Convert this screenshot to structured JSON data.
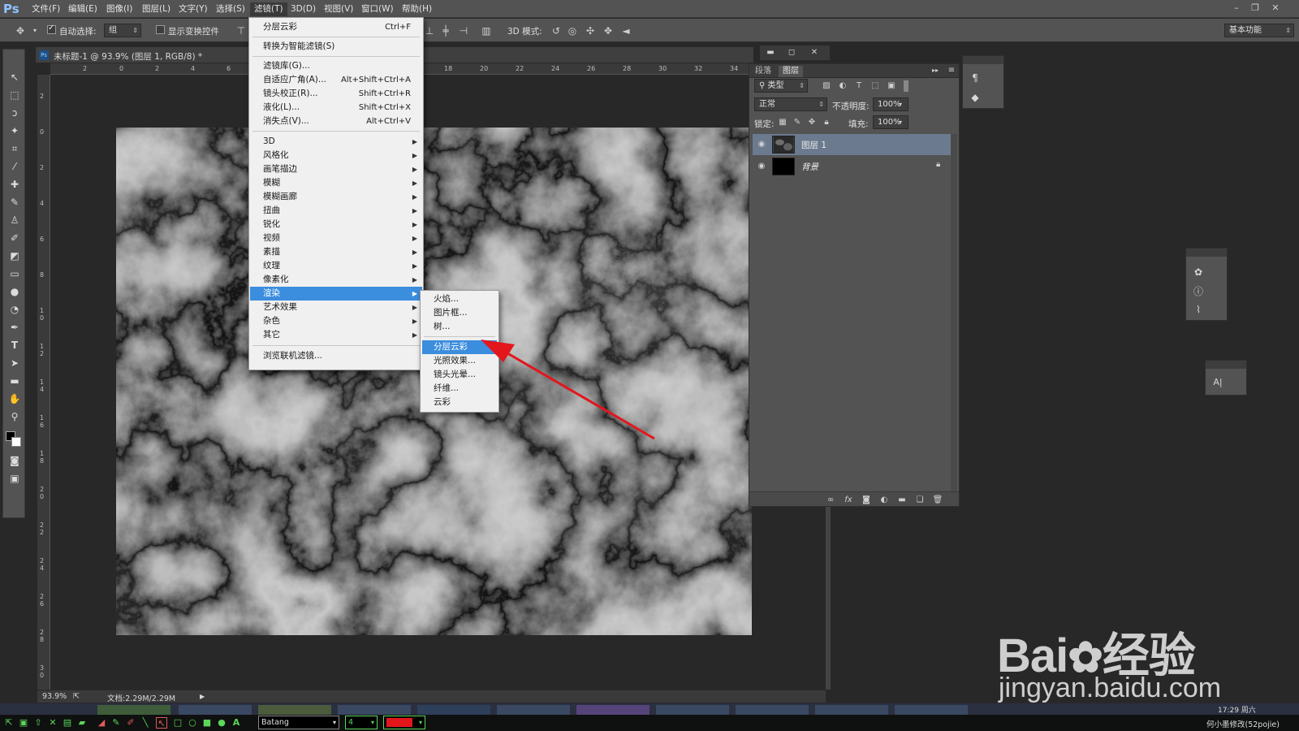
{
  "app": {
    "logo": "Ps"
  },
  "menubar": {
    "items": [
      "文件(F)",
      "编辑(E)",
      "图像(I)",
      "图层(L)",
      "文字(Y)",
      "选择(S)",
      "滤镜(T)",
      "3D(D)",
      "视图(V)",
      "窗口(W)",
      "帮助(H)"
    ],
    "active_index": 6
  },
  "options": {
    "auto_select_label": "自动选择:",
    "auto_select_value": "组",
    "show_transform_label": "显示变换控件",
    "mode3d_label": "3D 模式:",
    "workspace": "基本功能"
  },
  "document": {
    "title": "未标题-1 @ 93.9% (图层 1, RGB/8) *",
    "zoom": "93.9%",
    "doc_size": "文档:2.29M/2.29M",
    "ruler_h": [
      "2",
      "0",
      "2",
      "4",
      "6",
      "18",
      "20",
      "22",
      "24",
      "26",
      "28",
      "30",
      "32",
      "34"
    ],
    "ruler_v": [
      "2",
      "0",
      "2",
      "4",
      "6",
      "8",
      "1 0",
      "1 2",
      "1 4",
      "1 6",
      "1 8",
      "2 0",
      "2 2",
      "2 4",
      "2 6",
      "2 8",
      "3 0"
    ]
  },
  "filter_menu": {
    "top_items": [
      {
        "label": "分层云彩",
        "shortcut": "Ctrl+F"
      },
      {
        "label": "转换为智能滤镜(S)",
        "shortcut": ""
      }
    ],
    "mid_items": [
      {
        "label": "滤镜库(G)...",
        "shortcut": ""
      },
      {
        "label": "自适应广角(A)...",
        "shortcut": "Alt+Shift+Ctrl+A"
      },
      {
        "label": "镜头校正(R)...",
        "shortcut": "Shift+Ctrl+R"
      },
      {
        "label": "液化(L)...",
        "shortcut": "Shift+Ctrl+X"
      },
      {
        "label": "消失点(V)...",
        "shortcut": "Alt+Ctrl+V"
      }
    ],
    "sub_items": [
      "3D",
      "风格化",
      "画笔描边",
      "模糊",
      "模糊画廊",
      "扭曲",
      "锐化",
      "视频",
      "素描",
      "纹理",
      "像素化",
      "渲染",
      "艺术效果",
      "杂色",
      "其它"
    ],
    "highlight_sub": "渲染",
    "bottom_item": "浏览联机滤镜..."
  },
  "render_menu": {
    "items": [
      "火焰...",
      "图片框...",
      "树...",
      "分层云彩",
      "光照效果...",
      "镜头光晕...",
      "纤维...",
      "云彩"
    ],
    "highlight": "分层云彩"
  },
  "layers_panel": {
    "tabs": [
      "段落",
      "图层"
    ],
    "active_tab": "图层",
    "filter_kind": "类型",
    "blend_mode": "正常",
    "opacity_label": "不透明度:",
    "opacity_value": "100%",
    "lock_label": "锁定:",
    "fill_label": "填充:",
    "fill_value": "100%",
    "layers": [
      {
        "name": "图层 1",
        "selected": true
      },
      {
        "name": "背景",
        "selected": false,
        "locked": true
      }
    ]
  },
  "taskbar": {
    "font_select": "Batang",
    "size_select": "4",
    "clock": "17:29 周六",
    "credit": "何小墨修改(52pojie)"
  },
  "watermark": {
    "brand_a": "Bai",
    "brand_b": "经验",
    "url": "jingyan.baidu.com"
  },
  "colors": {
    "highlight": "#3b8dde",
    "arrow": "#e3161c",
    "ps_blue": "#8fc4ff"
  }
}
